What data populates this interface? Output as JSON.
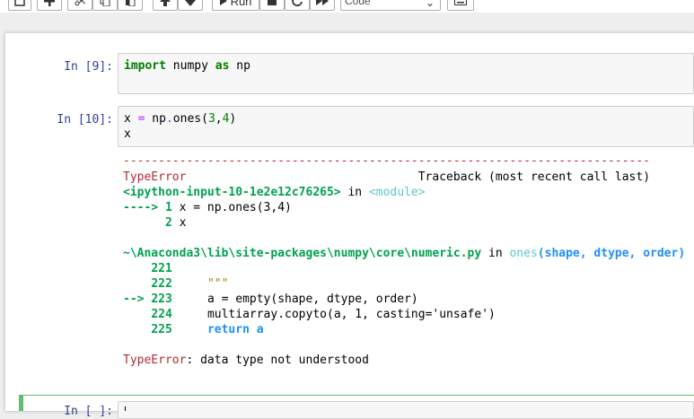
{
  "toolbar": {
    "run_label": "Run",
    "cell_type": "Code",
    "icons": [
      "save-icon",
      "add-cell-icon",
      "cut-icon",
      "copy-icon",
      "paste-icon",
      "move-up-icon",
      "move-down-icon",
      "run-icon",
      "stop-icon",
      "restart-icon",
      "fast-forward-icon",
      "keyboard-icon"
    ]
  },
  "cells": [
    {
      "prompt": "In [9]:",
      "code": [
        "import numpy as np"
      ]
    },
    {
      "prompt": "In [10]:",
      "code": [
        "x = np.ones(3,4)",
        "x"
      ]
    },
    {
      "prompt": "In [ ]:"
    }
  ],
  "traceback": {
    "dash_line": "---------------------------------------------------------------------------",
    "error_name": "TypeError",
    "traceback_label": "Traceback (most recent call last)",
    "input_ref": "<ipython-input-10-1e2e12c76265>",
    "in_word": "in",
    "module": "<module>",
    "arrow1": "---->",
    "line1_no": "1",
    "line1_code": "x = np.ones(3,4)",
    "line2_no": "2",
    "line2_code": "x",
    "file_path": "~\\Anaconda3\\lib\\site-packages\\numpy\\core\\numeric.py",
    "func_name": "ones",
    "func_args": "(shape, dtype, order)",
    "lines": [
      {
        "no": "221",
        "code": ""
      },
      {
        "no": "222",
        "code": "\"\"\""
      },
      {
        "no": "223",
        "code": "a = empty(shape, dtype, order)",
        "arrow": "-->"
      },
      {
        "no": "224",
        "code": "multiarray.copyto(a, 1, casting='unsafe')"
      },
      {
        "no": "225",
        "code": "return a"
      }
    ],
    "final_error": "TypeError",
    "final_message": ": data type not understood"
  }
}
